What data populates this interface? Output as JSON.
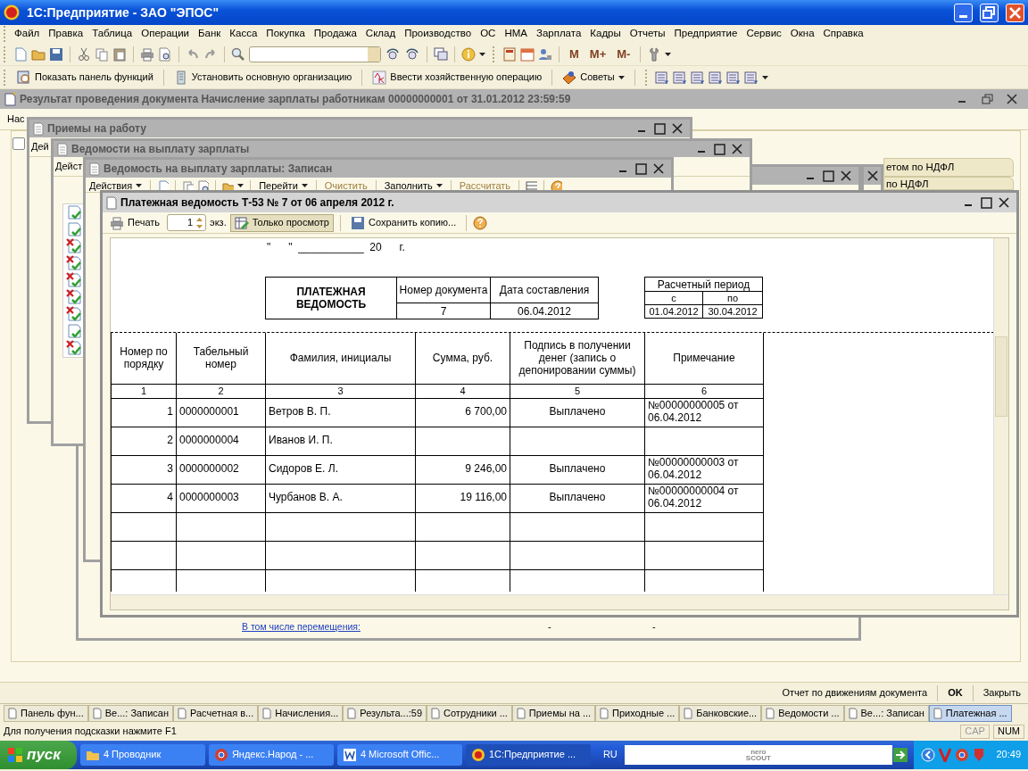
{
  "app_window": {
    "title": "1С:Предприятие - ЗАО \"ЭПОС\""
  },
  "menu": [
    "Файл",
    "Правка",
    "Таблица",
    "Операции",
    "Банк",
    "Касса",
    "Покупка",
    "Продажа",
    "Склад",
    "Производство",
    "ОС",
    "НМА",
    "Зарплата",
    "Кадры",
    "Отчеты",
    "Предприятие",
    "Сервис",
    "Окна",
    "Справка"
  ],
  "memory_buttons": [
    "M",
    "M+",
    "M-"
  ],
  "toolbar2": [
    {
      "label": "Показать панель функций",
      "dropdown": false
    },
    {
      "label": "Установить основную организацию",
      "dropdown": false
    },
    {
      "label": "Ввести хозяйственную операцию",
      "dropdown": false
    },
    {
      "label": "Советы",
      "dropdown": true
    }
  ],
  "result_window": {
    "title": "Результат проведения документа Начисление зарплаты работникам 00000000001 от 31.01.2012 23:59:59",
    "toolbar_fragment": "Нас",
    "checkbox_checked": false,
    "tab_fragments": [
      "етом по НДФЛ",
      "по НДФЛ"
    ],
    "footer_buttons": [
      "Отчет по движениям документа",
      "OK",
      "Закрыть"
    ]
  },
  "hidden_window": {
    "link": "В том числе перемещения:",
    "dash_1": "-",
    "dash_2": "-"
  },
  "back_windows": [
    {
      "title": "Приемы на работу",
      "fragment": "Дей"
    },
    {
      "title": "Ведомости на выплату зарплаты",
      "fragment": "Дейст",
      "doc_rows": [
        {
          "marked_deleted": false
        },
        {
          "marked_deleted": false
        },
        {
          "marked_deleted": true
        },
        {
          "marked_deleted": true
        },
        {
          "marked_deleted": true
        },
        {
          "marked_deleted": true
        },
        {
          "marked_deleted": true
        },
        {
          "marked_deleted": false
        },
        {
          "marked_deleted": true
        }
      ]
    },
    {
      "title": "Ведомость на выплату зарплаты: Записан",
      "toolbar": [
        {
          "label": "Действия",
          "dropdown": true,
          "disabled": false
        },
        {
          "label": "Перейти",
          "dropdown": true,
          "disabled": false
        },
        {
          "label": "Очистить",
          "dropdown": false,
          "disabled": true
        },
        {
          "label": "Заполнить",
          "dropdown": true,
          "disabled": false
        },
        {
          "label": "Рассчитать",
          "dropdown": false,
          "disabled": true
        }
      ]
    }
  ],
  "front_window": {
    "title": "Платежная ведомость Т-53  № 7 от 06 апреля 2012 г.",
    "toolbar": {
      "print": "Печать",
      "copies": "1",
      "copies_unit": "экз.",
      "view_only": {
        "label": "Только просмотр",
        "selected": true
      },
      "save_copy": "Сохранить копию..."
    },
    "sheet": {
      "date_line": "\"      \"  ___________  20      г.",
      "form_title": "ПЛАТЕЖНАЯ ВЕДОМОСТЬ",
      "number_label": "Номер документа",
      "number": "7",
      "date_label": "Дата составления",
      "date": "06.04.2012",
      "period_label": "Расчетный период",
      "from_label": "с",
      "to_label": "по",
      "from": "01.04.2012",
      "to": "30.04.2012",
      "columns": [
        "Номер по порядку",
        "Табельный номер",
        "Фамилия, инициалы",
        "Сумма, руб.",
        "Подпись в получении денег (запись о депонировании суммы)",
        "Примечание"
      ],
      "column_numbers": [
        "1",
        "2",
        "3",
        "4",
        "5",
        "6"
      ],
      "rows": [
        [
          "1",
          "0000000001",
          "Ветров В. П.",
          "6 700,00",
          "Выплачено",
          "№00000000005 от 06.04.2012"
        ],
        [
          "2",
          "0000000004",
          "Иванов И. П.",
          "",
          "",
          ""
        ],
        [
          "3",
          "0000000002",
          "Сидоров Е. Л.",
          "9 246,00",
          "Выплачено",
          "№00000000003 от 06.04.2012"
        ],
        [
          "4",
          "0000000003",
          "Чурбанов В. А.",
          "19 116,00",
          "Выплачено",
          "№00000000004 от 06.04.2012"
        ]
      ]
    }
  },
  "window_bar": [
    {
      "label": "Панель фун...",
      "selected": false
    },
    {
      "label": "Ве...: Записан",
      "selected": false
    },
    {
      "label": "Расчетная в...",
      "selected": false
    },
    {
      "label": "Начисления...",
      "selected": false
    },
    {
      "label": "Результа...:59",
      "selected": false
    },
    {
      "label": "Сотрудники ...",
      "selected": false
    },
    {
      "label": "Приемы на ...",
      "selected": false
    },
    {
      "label": "Приходные ...",
      "selected": false
    },
    {
      "label": "Банковские...",
      "selected": false
    },
    {
      "label": "Ведомости ...",
      "selected": false
    },
    {
      "label": "Ве...: Записан",
      "selected": false
    },
    {
      "label": "Платежная ...",
      "selected": true
    }
  ],
  "status_bar": {
    "hint": "Для получения подсказки нажмите F1",
    "indicators": [
      {
        "label": "CAP",
        "on": false
      },
      {
        "label": "NUM",
        "on": true
      }
    ]
  },
  "taskbar": {
    "start": "пуск",
    "items": [
      {
        "count": "4",
        "label": "Проводник",
        "selected": false
      },
      {
        "label": "Яндекс.Народ - ...",
        "selected": false
      },
      {
        "count": "4",
        "label": "Microsoft Offic...",
        "selected": false
      },
      {
        "label": "1С:Предприятие ...",
        "selected": true
      }
    ],
    "language": "RU",
    "search_logo": [
      "nero",
      "SCOUT"
    ],
    "clock": "20:49"
  }
}
